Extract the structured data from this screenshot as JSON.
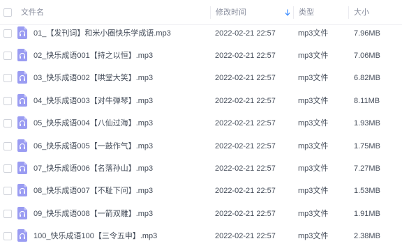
{
  "header": {
    "name": "文件名",
    "modified": "修改时间",
    "type": "类型",
    "size": "大小"
  },
  "files": [
    {
      "name": "01_【发刊词】和米小圈快乐学成语.mp3",
      "modified": "2022-02-21 22:57",
      "type": "mp3文件",
      "size": "7.96MB"
    },
    {
      "name": "02_快乐成语001【持之以恒】.mp3",
      "modified": "2022-02-21 22:57",
      "type": "mp3文件",
      "size": "7.06MB"
    },
    {
      "name": "03_快乐成语002【哄堂大笑】.mp3",
      "modified": "2022-02-21 22:57",
      "type": "mp3文件",
      "size": "6.82MB"
    },
    {
      "name": "04_快乐成语003【对牛弹琴】.mp3",
      "modified": "2022-02-21 22:57",
      "type": "mp3文件",
      "size": "8.11MB"
    },
    {
      "name": "05_快乐成语004【八仙过海】.mp3",
      "modified": "2022-02-21 22:57",
      "type": "mp3文件",
      "size": "1.93MB"
    },
    {
      "name": "06_快乐成语005【一鼓作气】.mp3",
      "modified": "2022-02-21 22:57",
      "type": "mp3文件",
      "size": "1.75MB"
    },
    {
      "name": "07_快乐成语006【名落孙山】.mp3",
      "modified": "2022-02-21 22:57",
      "type": "mp3文件",
      "size": "7.27MB"
    },
    {
      "name": "08_快乐成语007【不耻下问】.mp3",
      "modified": "2022-02-21 22:57",
      "type": "mp3文件",
      "size": "1.53MB"
    },
    {
      "name": "09_快乐成语008【一箭双雕】.mp3",
      "modified": "2022-02-21 22:57",
      "type": "mp3文件",
      "size": "1.91MB"
    },
    {
      "name": "100_快乐成语100【三令五申】.mp3",
      "modified": "2022-02-21 22:57",
      "type": "mp3文件",
      "size": "2.38MB"
    }
  ],
  "icons": {
    "file": "audio-file-icon",
    "sort": "sort-descending-icon"
  },
  "colors": {
    "audio_icon": "#9a9cf2",
    "sort_arrow": "#3b8cff"
  }
}
